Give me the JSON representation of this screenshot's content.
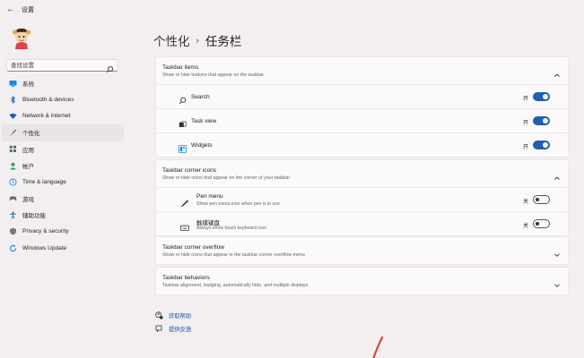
{
  "window": {
    "title": "设置",
    "back_glyph": "←"
  },
  "search": {
    "placeholder": "查找设置"
  },
  "sidebar": {
    "items": [
      {
        "label": "系统",
        "icon": "monitor-icon",
        "color": "#1e88e5"
      },
      {
        "label": "Bluetooth & devices",
        "icon": "bluetooth-icon",
        "color": "#1565c0"
      },
      {
        "label": "Network & internet",
        "icon": "wifi-icon",
        "color": "#1e5aa8"
      },
      {
        "label": "个性化",
        "icon": "brush-icon",
        "color": "#555555",
        "selected": true
      },
      {
        "label": "应用",
        "icon": "apps-icon",
        "color": "#5a6a7a"
      },
      {
        "label": "帐户",
        "icon": "person-icon",
        "color": "#2e9f5a"
      },
      {
        "label": "Time & language",
        "icon": "globe-clock-icon",
        "color": "#1e88e5"
      },
      {
        "label": "游戏",
        "icon": "gamepad-icon",
        "color": "#6b6b6b"
      },
      {
        "label": "辅助功能",
        "icon": "accessibility-icon",
        "color": "#1e5aa8"
      },
      {
        "label": "Privacy & security",
        "icon": "shield-icon",
        "color": "#777777"
      },
      {
        "label": "Windows Update",
        "icon": "update-icon",
        "color": "#1e88e5"
      }
    ]
  },
  "breadcrumb": {
    "parent": "个性化",
    "separator": "›",
    "current": "任务栏"
  },
  "sections": {
    "taskbar_items": {
      "title": "Taskbar items",
      "subtitle": "Show or hide buttons that appear on the taskbar",
      "rows": [
        {
          "label": "Search",
          "icon": "search-icon",
          "state": "开",
          "on": true
        },
        {
          "label": "Task view",
          "icon": "task-view-icon",
          "state": "开",
          "on": true
        },
        {
          "label": "Widgets",
          "icon": "widgets-icon",
          "state": "开",
          "on": true
        }
      ]
    },
    "corner_icons": {
      "title": "Taskbar corner icons",
      "subtitle": "Show or hide icons that appear on the corner of your taskbar",
      "rows": [
        {
          "label": "Pen menu",
          "sub": "Show pen menu icon when pen is in use",
          "icon": "pen-icon",
          "state": "关",
          "on": false
        },
        {
          "label": "触摸键盘",
          "sub": "Always show touch keyboard icon",
          "icon": "keyboard-icon",
          "state": "关",
          "on": false
        }
      ]
    },
    "corner_overflow": {
      "title": "Taskbar corner overflow",
      "subtitle": "Show or hide icons that appear in the taskbar corner overflow menu"
    },
    "behaviors": {
      "title": "Taskbar behaviors",
      "subtitle": "Taskbar alignment, badging, automatically hide, and multiple displays"
    }
  },
  "links": {
    "help": "获取帮助",
    "feedback": "提供反馈"
  },
  "colors": {
    "accent": "#1f5fb0",
    "link": "#1e5aa8",
    "background": "#f3eff0"
  }
}
